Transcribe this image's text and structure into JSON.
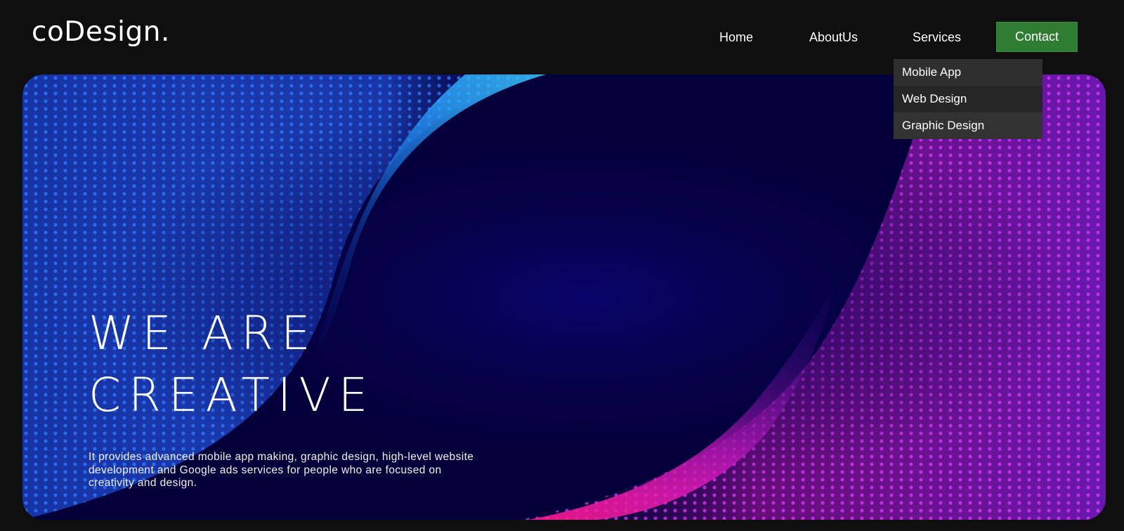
{
  "brand": {
    "logo_text": "coDesign."
  },
  "nav": {
    "home": "Home",
    "about": "AboutUs",
    "services": "Services",
    "contact": "Contact"
  },
  "services_menu": {
    "items": [
      {
        "label": "Mobile App"
      },
      {
        "label": "Web Design"
      },
      {
        "label": "Graphic Design"
      }
    ]
  },
  "hero": {
    "headline_line1": "WE ARE",
    "headline_line2": "CREATIVE",
    "description": "It provides advanced mobile app making, graphic design, high-level website development and Google ads services for people who are focused on creativity and design."
  },
  "colors": {
    "page_background": "#0f0f0f",
    "contact_button": "#2e7d32",
    "hero_background": "#04003a",
    "wave_blue": "#2aa8ff",
    "wave_magenta": "#ff1aa6"
  }
}
